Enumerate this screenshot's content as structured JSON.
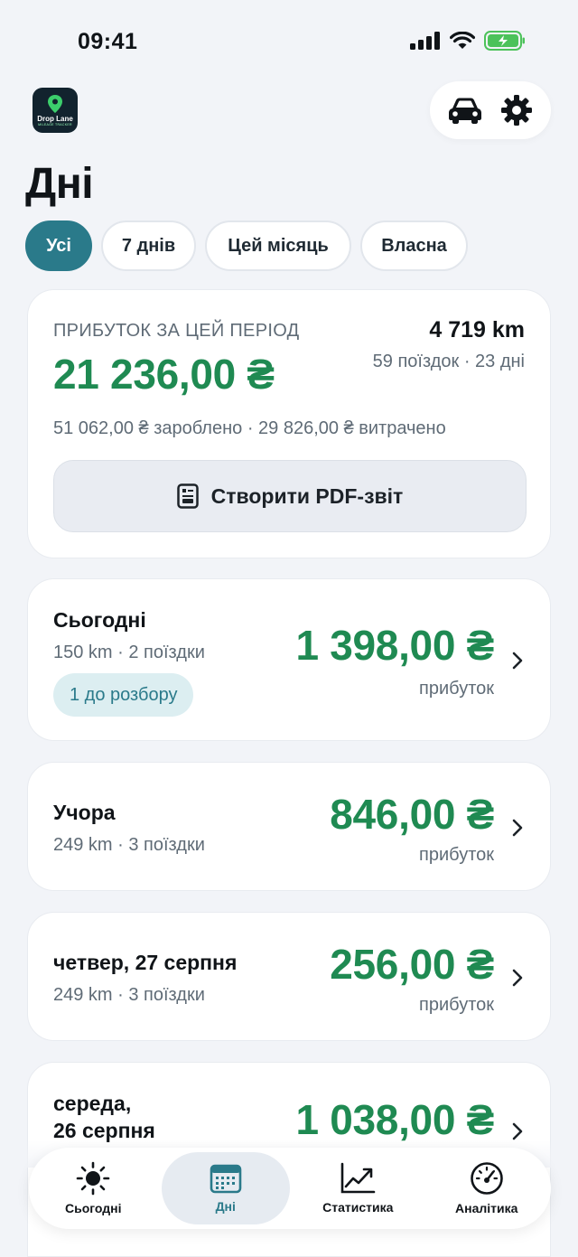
{
  "status": {
    "time": "09:41"
  },
  "header": {
    "logo_text": "Drop Lane",
    "logo_sub": "MILEAGE TRACKER",
    "title": "Дні"
  },
  "filters": [
    {
      "label": "Усі",
      "active": true
    },
    {
      "label": "7 днів",
      "active": false
    },
    {
      "label": "Цей місяць",
      "active": false
    },
    {
      "label": "Власна",
      "active": false
    }
  ],
  "summary": {
    "label": "ПРИБУТОК ЗА ЦЕЙ ПЕРІОД",
    "profit": "21 236,00 ₴",
    "km": "4 719 km",
    "meta": "59 поїздок · 23 дні",
    "totals": "51 062,00 ₴ зароблено · 29 826,00 ₴ витрачено",
    "pdf_button": "Створити PDF-звіт"
  },
  "days": [
    {
      "title": "Сьогодні",
      "meta": "150 km · 2 поїздки",
      "amount": "1 398,00 ₴",
      "sub": "прибуток",
      "pill": "1 до розбору"
    },
    {
      "title": "Учора",
      "meta": "249 km · 3 поїздки",
      "amount": "846,00 ₴",
      "sub": "прибуток"
    },
    {
      "title": "четвер, 27 серпня",
      "meta": "249 km · 3 поїздки",
      "amount": "256,00 ₴",
      "sub": "прибуток"
    },
    {
      "title": "середа,\n26 серпня",
      "amount": "1 038,00 ₴"
    }
  ],
  "tabs": [
    {
      "label": "Сьогодні",
      "icon": "sun-icon"
    },
    {
      "label": "Дні",
      "icon": "calendar-icon",
      "active": true
    },
    {
      "label": "Статистика",
      "icon": "chart-icon"
    },
    {
      "label": "Аналітика",
      "icon": "gauge-icon"
    }
  ],
  "colors": {
    "accent": "#2a7a8a",
    "profit": "#1f8a52",
    "background": "#f2f4f8"
  }
}
